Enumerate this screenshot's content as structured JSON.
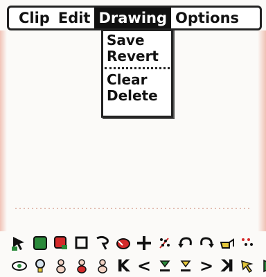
{
  "menubar": {
    "items": [
      {
        "label": "Clip"
      },
      {
        "label": "Edit"
      },
      {
        "label": "Drawing"
      },
      {
        "label": "Options"
      }
    ]
  },
  "dropdown": {
    "items": [
      {
        "label": "Save"
      },
      {
        "label": "Revert"
      },
      {
        "label": "Clear"
      },
      {
        "label": "Delete"
      }
    ]
  },
  "toolbar_row2": {
    "first_glyph": "K",
    "prev_glyph": "<",
    "next_glyph": ">",
    "last_glyph": "K"
  },
  "colors": {
    "menu_active_bg": "#111111",
    "accent_red": "#d42a2a",
    "accent_green": "#2a8a3a",
    "accent_yellow": "#e3c63a"
  }
}
